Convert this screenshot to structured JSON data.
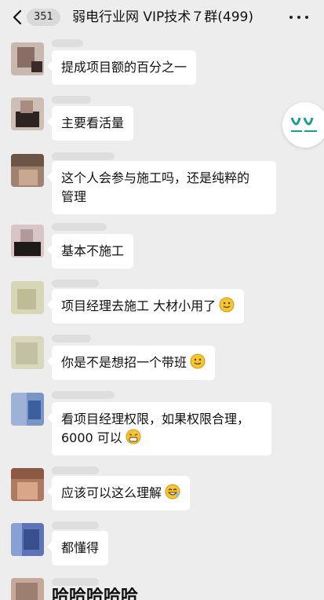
{
  "header": {
    "back_icon": "chevron-left-icon",
    "unread_count": "351",
    "title": "弱电行业网 VIP技术７群(499)",
    "more_icon": "more-dots-icon"
  },
  "messages": [
    {
      "text": "提成项目额的百分之一"
    },
    {
      "text": "主要看活量"
    },
    {
      "text_line1": "这个人会参与施工吗，还是纯粹的",
      "text_line2": "管理"
    },
    {
      "text": "基本不施工"
    },
    {
      "text": "项目经理去施工 大材小用了",
      "emoji": "smile-emoji-icon"
    },
    {
      "text": "你是不是想招一个带班",
      "emoji": "smile-emoji-icon"
    },
    {
      "text_line1": "看项目经理权限，如果权限合理，",
      "text_line2": "6000 可以",
      "emoji": "grin-emoji-icon"
    },
    {
      "text": "应该可以这么理解",
      "emoji": "laugh-emoji-icon"
    },
    {
      "text": "都懂得"
    },
    {
      "text": "哈哈哈哈哈"
    }
  ],
  "colors": {
    "background": "#ededed",
    "bubble": "#ffffff",
    "logo_green": "#1a9e8f"
  }
}
